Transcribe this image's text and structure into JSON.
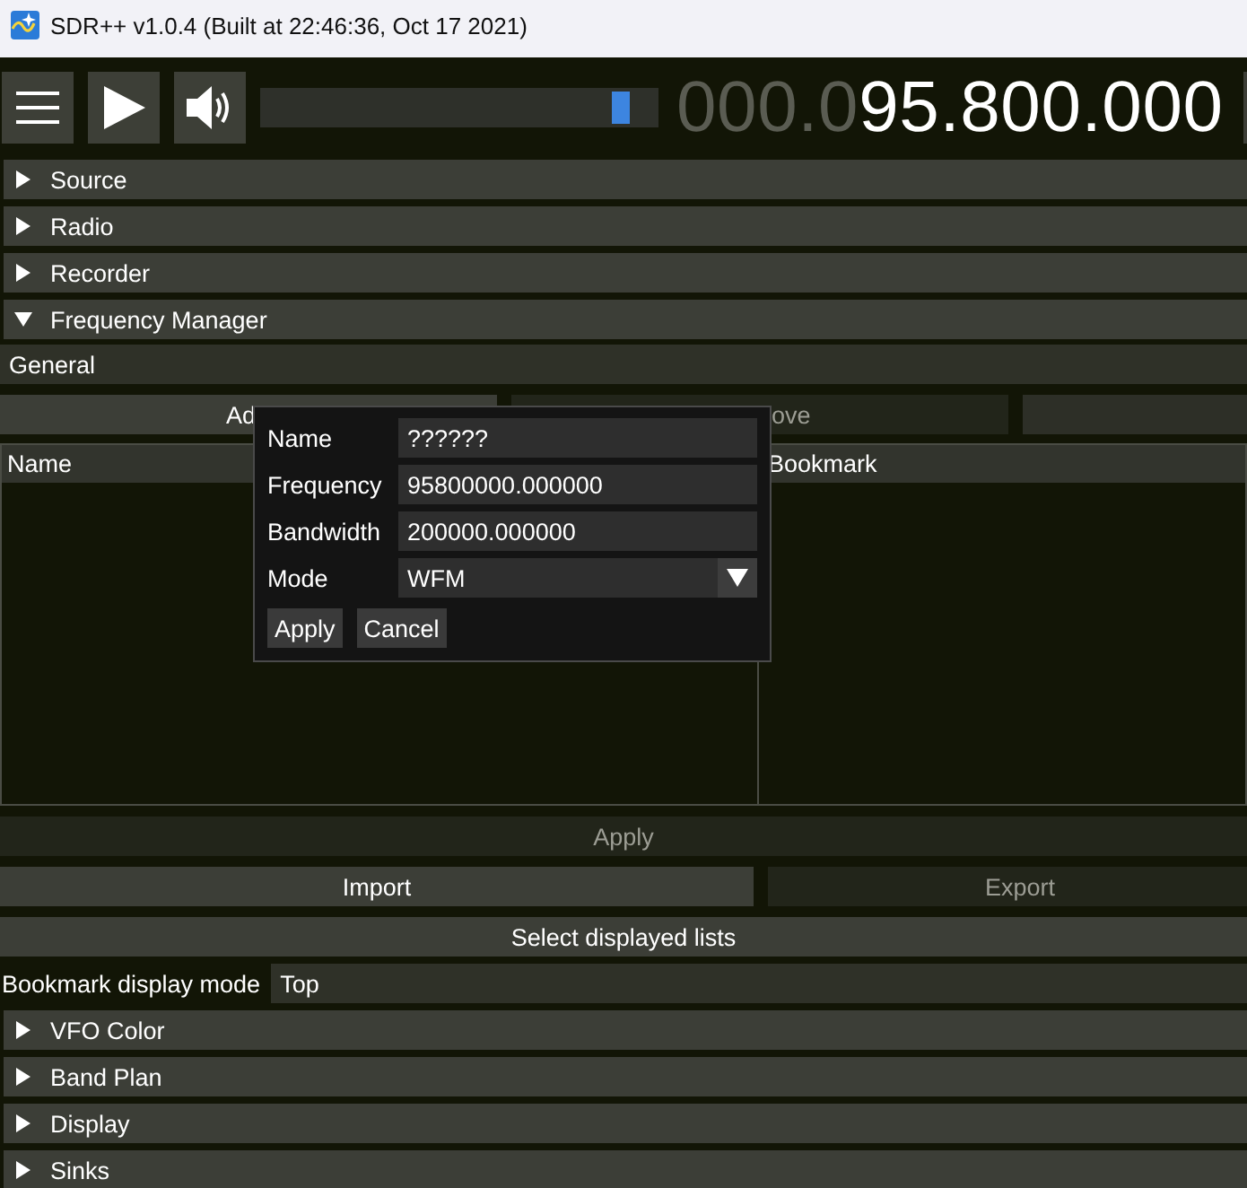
{
  "window": {
    "title": "SDR++ v1.0.4 (Built at 22:46:36, Oct 17 2021)"
  },
  "toolbar": {
    "volume": {
      "level": 0.93
    },
    "frequency": {
      "leading": "000.0",
      "value": "95.800.000"
    }
  },
  "modules": [
    {
      "label": "Source",
      "expanded": false
    },
    {
      "label": "Radio",
      "expanded": false
    },
    {
      "label": "Recorder",
      "expanded": false
    },
    {
      "label": "Frequency Manager",
      "expanded": true
    },
    {
      "label": "VFO Color",
      "expanded": false
    },
    {
      "label": "Band Plan",
      "expanded": false
    },
    {
      "label": "Display",
      "expanded": false
    },
    {
      "label": "Sinks",
      "expanded": false
    }
  ],
  "frequency_manager": {
    "list": "General",
    "list_buttons": [
      {
        "label": "Ad",
        "disabled": false
      },
      {
        "label": "ove",
        "disabled": true
      }
    ],
    "table": {
      "columns": [
        "Name",
        "Bookmark"
      ]
    },
    "apply": {
      "label": "Apply",
      "disabled": true
    },
    "io_buttons": [
      {
        "label": "Import",
        "disabled": false
      },
      {
        "label": "Export",
        "disabled": true
      }
    ],
    "select_lists": {
      "label": "Select displayed lists",
      "disabled": false
    },
    "display_mode": {
      "label": "Bookmark display mode",
      "value": "Top"
    }
  },
  "dialog": {
    "fields": [
      {
        "label": "Name",
        "value": "??????",
        "kind": "text"
      },
      {
        "label": "Frequency",
        "value": "95800000.000000",
        "kind": "text"
      },
      {
        "label": "Bandwidth",
        "value": "200000.000000",
        "kind": "text"
      },
      {
        "label": "Mode",
        "value": "WFM",
        "kind": "combo"
      }
    ],
    "buttons": [
      {
        "label": "Apply"
      },
      {
        "label": "Cancel"
      }
    ]
  }
}
